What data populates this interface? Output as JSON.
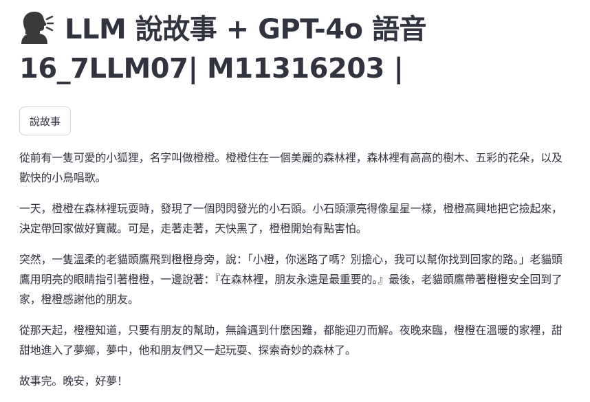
{
  "header": {
    "title_line1": "LLM 說故事 + GPT-4o 語音",
    "title_line2": "16_7LLM07| M11316203 |",
    "icon": "speaking-head-icon"
  },
  "actions": {
    "tell_story_label": "說故事"
  },
  "story": {
    "paragraphs": [
      "從前有一隻可愛的小狐狸，名字叫做橙橙。橙橙住在一個美麗的森林裡，森林裡有高高的樹木、五彩的花朵，以及歡快的小鳥唱歌。",
      "一天，橙橙在森林裡玩耍時，發現了一個閃閃發光的小石頭。小石頭漂亮得像星星一樣，橙橙高興地把它撿起來，決定帶回家做好寶藏。可是，走著走著，天快黑了，橙橙開始有點害怕。",
      "突然，一隻溫柔的老貓頭鷹飛到橙橙身旁，說：「小橙，你迷路了嗎？別擔心，我可以幫你找到回家的路。」老貓頭鷹用明亮的眼睛指引著橙橙，一邊說著：『在森林裡，朋友永遠是最重要的。』最後，老貓頭鷹帶著橙橙安全回到了家，橙橙感謝他的朋友。",
      "從那天起，橙橙知道，只要有朋友的幫助，無論遇到什麼困難，都能迎刃而解。夜晚來臨，橙橙在溫暖的家裡，甜甜地進入了夢鄉，夢中，他和朋友們又一起玩耍、探索奇妙的森林了。",
      "故事完。晚安，好夢！"
    ]
  }
}
